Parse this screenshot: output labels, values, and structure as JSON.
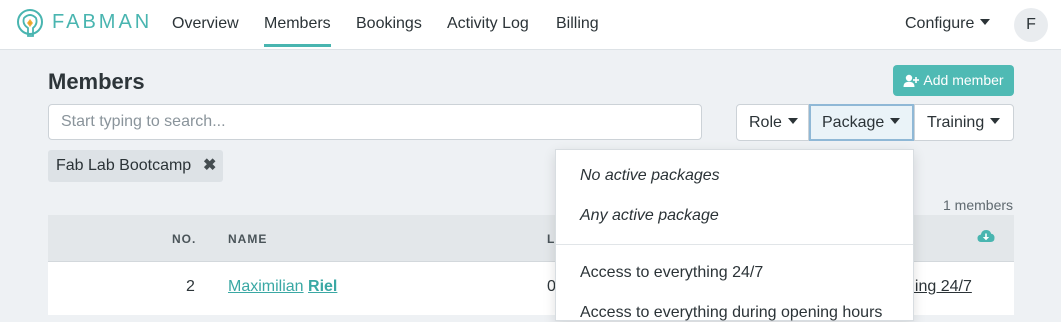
{
  "brand": {
    "name": "FABMAN"
  },
  "nav": {
    "items": [
      {
        "label": "Overview"
      },
      {
        "label": "Members"
      },
      {
        "label": "Bookings"
      },
      {
        "label": "Activity Log"
      },
      {
        "label": "Billing"
      }
    ],
    "active": "Members",
    "configure_label": "Configure",
    "avatar_initial": "F"
  },
  "page": {
    "title": "Members",
    "add_button_label": "Add member"
  },
  "search": {
    "placeholder": "Start typing to search...",
    "value": ""
  },
  "filters": {
    "role_label": "Role",
    "package_label": "Package",
    "training_label": "Training",
    "active_chip": "Fab Lab Bootcamp"
  },
  "table": {
    "count_text": "1 members",
    "headers": {
      "no": "NO.",
      "name": "NAME",
      "third": "L"
    },
    "rows": [
      {
        "no": "2",
        "first_name": "Maximilian",
        "last_name": "Riel",
        "third_partial": "0",
        "package_partial": "ning 24/7"
      }
    ]
  },
  "package_dropdown": {
    "special_options": [
      "No active packages",
      "Any active package"
    ],
    "options": [
      "Access to everything 24/7",
      "Access to everything during opening hours"
    ]
  },
  "colors": {
    "accent": "#49b5b0",
    "button_bg": "#4fbab4",
    "link": "#3aa8a4",
    "page_bg": "#eef1f4"
  },
  "icons": {
    "logo": "fabman-logo-icon",
    "add_member": "user-plus-icon",
    "chip_remove": "close-icon",
    "download": "cloud-download-icon",
    "dropdown": "caret-down-icon"
  }
}
